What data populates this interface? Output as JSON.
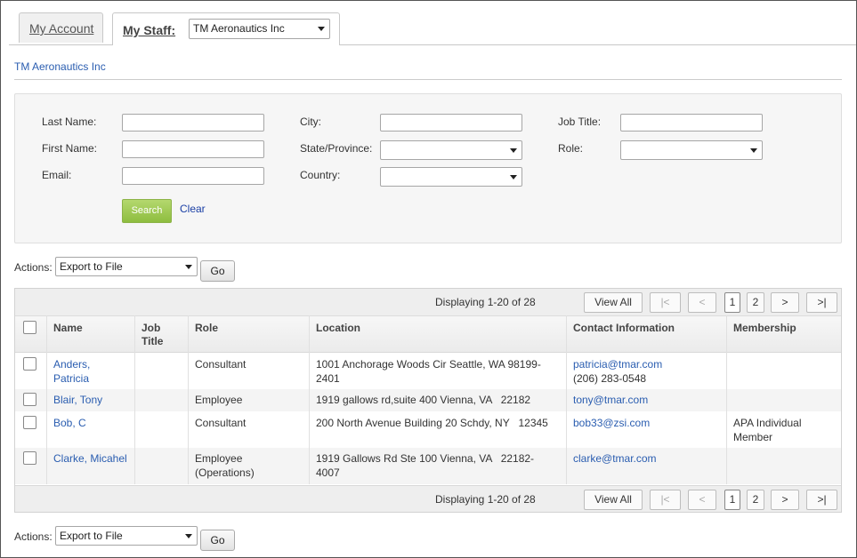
{
  "tabs": {
    "account_label": "My Account",
    "staff_label": "My Staff:",
    "staff_select_value": "TM Aeronautics Inc"
  },
  "org_link": "TM Aeronautics Inc",
  "search": {
    "last_name_label": "Last Name:",
    "first_name_label": "First Name:",
    "email_label": "Email:",
    "city_label": "City:",
    "state_label": "State/Province:",
    "country_label": "Country:",
    "job_title_label": "Job Title:",
    "role_label": "Role:",
    "search_button": "Search",
    "clear_link": "Clear"
  },
  "actions": {
    "label": "Actions:",
    "select_value": "Export to File",
    "go_button": "Go"
  },
  "pager": {
    "displaying": "Displaying 1-20 of 28",
    "view_all": "View All",
    "first": "|<",
    "prev": "<",
    "page1": "1",
    "page2": "2",
    "next": ">",
    "last": ">|"
  },
  "table": {
    "columns": {
      "name": "Name",
      "job_title": "Job\nTitle",
      "role": "Role",
      "location": "Location",
      "contact": "Contact Information",
      "membership": "Membership"
    },
    "rows": [
      {
        "name": "Anders,\nPatricia",
        "job_title": "",
        "role": "Consultant",
        "location": "1001 Anchorage Woods Cir Seattle, WA 98199-\n2401",
        "email": "patricia@tmar.com",
        "phone": "(206) 283-0548",
        "membership": ""
      },
      {
        "name": "Blair, Tony",
        "job_title": "",
        "role": "Employee",
        "location": "1919 gallows rd,suite 400 Vienna, VA   22182",
        "email": "tony@tmar.com",
        "phone": "",
        "membership": ""
      },
      {
        "name": "Bob, C",
        "job_title": "",
        "role": "Consultant",
        "location": "200 North Avenue Building 20 Schdy, NY   12345",
        "email": "bob33@zsi.com",
        "phone": "",
        "membership": "APA Individual\nMember"
      },
      {
        "name": "Clarke, Micahel",
        "job_title": "",
        "role": "Employee\n(Operations)",
        "location": "1919 Gallows Rd Ste 100 Vienna, VA   22182-\n4007",
        "email": "clarke@tmar.com",
        "phone": "",
        "membership": ""
      }
    ]
  }
}
